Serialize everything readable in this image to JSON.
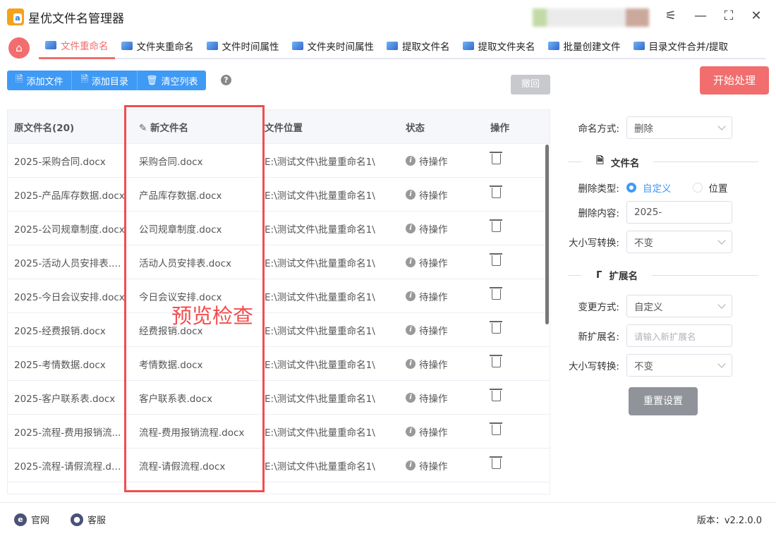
{
  "app": {
    "title": "星优文件名管理器",
    "logo_text": "a"
  },
  "tabs": [
    "文件重命名",
    "文件夹重命名",
    "文件时间属性",
    "文件夹时间属性",
    "提取文件名",
    "提取文件夹名",
    "批量创建文件",
    "目录文件合并/提取"
  ],
  "toolbar": {
    "add_file": "添加文件",
    "add_dir": "添加目录",
    "clear": "清空列表",
    "help": "?",
    "undo": "撤回",
    "start": "开始处理"
  },
  "table": {
    "headers": [
      "原文件名(20)",
      "新文件名",
      "文件位置",
      "状态",
      "操作"
    ],
    "rows": [
      {
        "orig": "2025-采购合同.docx",
        "new": "采购合同.docx",
        "loc": "E:\\测试文件\\批量重命名1\\",
        "status": "待操作"
      },
      {
        "orig": "2025-产品库存数据.docx",
        "new": "产品库存数据.docx",
        "loc": "E:\\测试文件\\批量重命名1\\",
        "status": "待操作"
      },
      {
        "orig": "2025-公司规章制度.docx",
        "new": "公司规章制度.docx",
        "loc": "E:\\测试文件\\批量重命名1\\",
        "status": "待操作"
      },
      {
        "orig": "2025-活动人员安排表.d...",
        "new": "活动人员安排表.docx",
        "loc": "E:\\测试文件\\批量重命名1\\",
        "status": "待操作"
      },
      {
        "orig": "2025-今日会议安排.docx",
        "new": "今日会议安排.docx",
        "loc": "E:\\测试文件\\批量重命名1\\",
        "status": "待操作"
      },
      {
        "orig": "2025-经费报销.docx",
        "new": "经费报销.docx",
        "loc": "E:\\测试文件\\批量重命名1\\",
        "status": "待操作"
      },
      {
        "orig": "2025-考情数据.docx",
        "new": "考情数据.docx",
        "loc": "E:\\测试文件\\批量重命名1\\",
        "status": "待操作"
      },
      {
        "orig": "2025-客户联系表.docx",
        "new": "客户联系表.docx",
        "loc": "E:\\测试文件\\批量重命名1\\",
        "status": "待操作"
      },
      {
        "orig": "2025-流程-费用报销流...",
        "new": "流程-费用报销流程.docx",
        "loc": "E:\\测试文件\\批量重命名1\\",
        "status": "待操作"
      },
      {
        "orig": "2025-流程-请假流程.do...",
        "new": "流程-请假流程.docx",
        "loc": "E:\\测试文件\\批量重命名1\\",
        "status": "待操作"
      }
    ]
  },
  "overlay": "预览检查",
  "panel": {
    "naming_label": "命名方式:",
    "naming_value": "删除",
    "filename_section": "文件名",
    "delete_type_label": "删除类型:",
    "delete_type_options": [
      "自定义",
      "位置"
    ],
    "delete_content_label": "删除内容:",
    "delete_content_value": "2025-",
    "case_label": "大小写转换:",
    "case_value": "不变",
    "ext_section": "扩展名",
    "change_label": "变更方式:",
    "change_value": "自定义",
    "new_ext_label": "新扩展名:",
    "new_ext_placeholder": "请输入新扩展名",
    "ext_case_label": "大小写转换:",
    "ext_case_value": "不变",
    "reset": "重置设置"
  },
  "footer": {
    "website": "官网",
    "support": "客服",
    "version": "版本：v2.2.0.0"
  }
}
